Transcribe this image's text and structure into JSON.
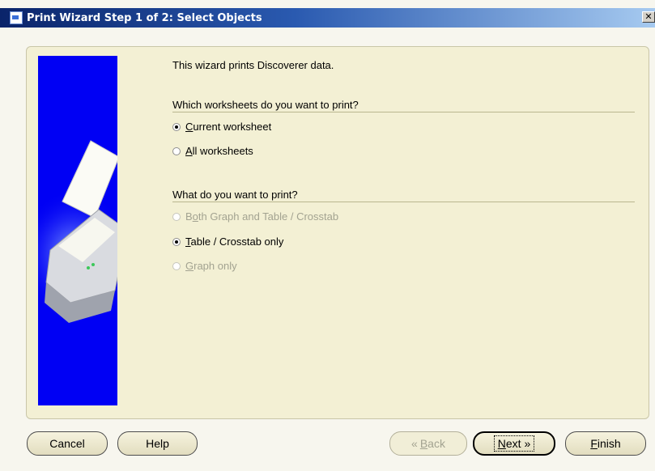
{
  "window": {
    "title": "Print Wizard Step 1 of 2: Select Objects",
    "close_glyph": "✕"
  },
  "content": {
    "intro": "This wizard prints Discoverer data.",
    "worksheets_question": "Which worksheets do you want to print?",
    "worksheet_options": [
      {
        "label_prefix": "",
        "mnemonic": "C",
        "label_rest": "urrent worksheet",
        "selected": true,
        "enabled": true
      },
      {
        "label_prefix": "",
        "mnemonic": "A",
        "label_rest": "ll worksheets",
        "selected": false,
        "enabled": true
      }
    ],
    "print_question": "What do you want to print?",
    "print_options": [
      {
        "label_prefix": "B",
        "mnemonic": "o",
        "label_rest": "th Graph and Table / Crosstab",
        "selected": false,
        "enabled": false
      },
      {
        "label_prefix": "",
        "mnemonic": "T",
        "label_rest": "able / Crosstab only",
        "selected": true,
        "enabled": true
      },
      {
        "label_prefix": "",
        "mnemonic": "G",
        "label_rest": "raph only",
        "selected": false,
        "enabled": false
      }
    ]
  },
  "buttons": {
    "cancel": "Cancel",
    "help": "Help",
    "back_mnemonic": "B",
    "back_rest": "ack",
    "back_glyph": "«",
    "next_mnemonic": "N",
    "next_rest": "ext",
    "next_glyph": "»",
    "finish_mnemonic": "F",
    "finish_rest": "inish"
  },
  "colors": {
    "titlebar": "#0a246a",
    "panel": "#f3f0d4",
    "side_image": "#0000f4"
  },
  "icons": {
    "title": "app-icon",
    "illustration": "printer-icon"
  }
}
